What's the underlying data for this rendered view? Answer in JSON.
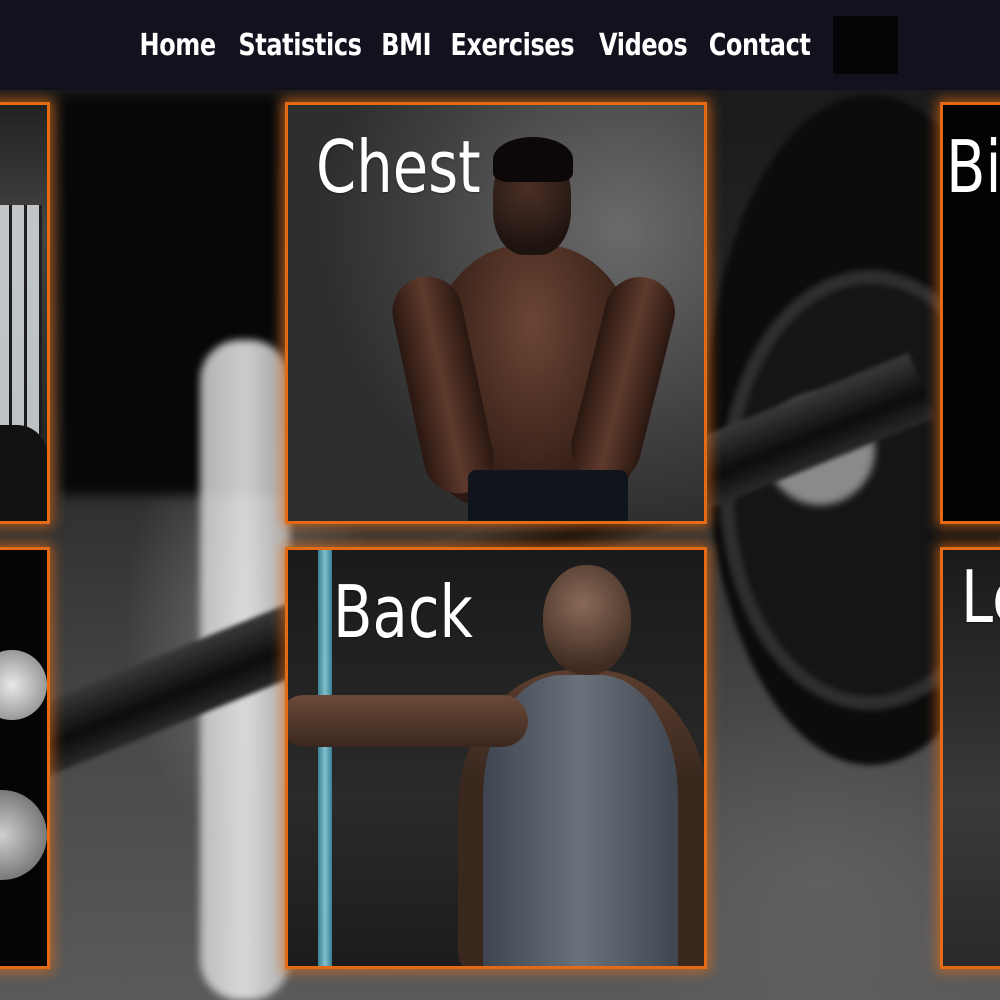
{
  "nav": {
    "links": [
      "Home",
      "Statistics",
      "BMI",
      "Exercises",
      "Videos",
      "Contact"
    ]
  },
  "cards": {
    "chest": {
      "title": "Chest"
    },
    "back": {
      "title": "Back"
    },
    "right_top": {
      "title": "Bi"
    },
    "right_bottom": {
      "title": "Le"
    }
  },
  "colors": {
    "navbar_bg": "#13111d",
    "card_border": "#e56a16",
    "text": "#ffffff"
  }
}
